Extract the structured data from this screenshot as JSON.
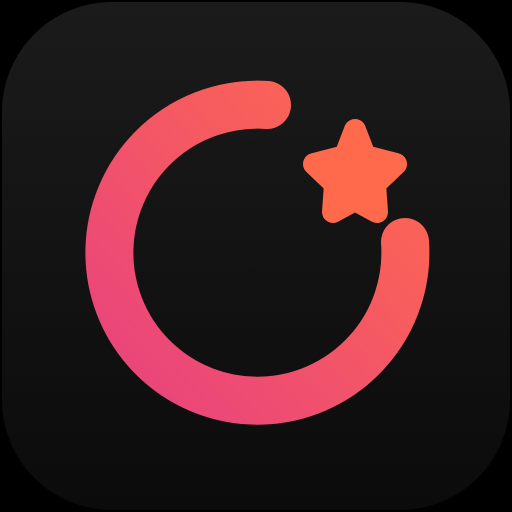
{
  "icon": {
    "name": "app-icon",
    "symbols": [
      "ring-icon",
      "star-icon"
    ]
  },
  "colors": {
    "background": "#000000",
    "tile_top": "#1b1b1b",
    "tile_bottom": "#0b0b0b",
    "gradient_pink": "#e8427f",
    "gradient_coral": "#ff6a4d",
    "star": "#ff6a4d"
  }
}
